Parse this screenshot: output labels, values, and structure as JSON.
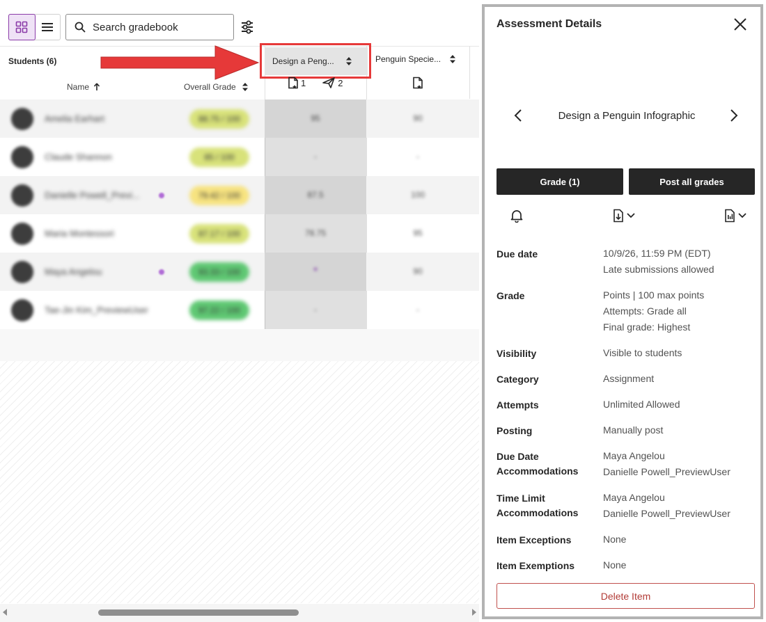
{
  "toolbar": {
    "search_placeholder": "Search gradebook"
  },
  "grid": {
    "students_label": "Students (6)",
    "name_header": "Name",
    "overall_header": "Overall Grade",
    "columns": [
      {
        "title": "Design a Peng...",
        "needs_grading_count": "1",
        "submitted_count": "2"
      },
      {
        "title": "Penguin Specie..."
      }
    ],
    "rows": [
      {
        "name": "Amelia Earhart",
        "overall": "88.75 / 100",
        "c1": "95",
        "c2": "90",
        "pill_color": "#d8e27a",
        "dot": false
      },
      {
        "name": "Claude Shannon",
        "overall": "85 / 100",
        "c1": "-",
        "c2": "-",
        "pill_color": "#d8e27a",
        "dot": false
      },
      {
        "name": "Danielle Powell_Previ...",
        "overall": "79.42 / 100",
        "c1": "87.5",
        "c2": "100",
        "pill_color": "#f7e380",
        "dot": true
      },
      {
        "name": "Maria Montessori",
        "overall": "87.17 / 100",
        "c1": "78.75",
        "c2": "95",
        "pill_color": "#d8e27a",
        "dot": false
      },
      {
        "name": "Maya Angelou",
        "overall": "93.33 / 100",
        "c1": "•",
        "c2": "90",
        "pill_color": "#5fc873",
        "dot": true
      },
      {
        "name": "Tae-Jin Kim_PreviewUser",
        "overall": "97.22 / 100",
        "c1": "-",
        "c2": "-",
        "pill_color": "#5fc873",
        "dot": false
      }
    ]
  },
  "panel": {
    "title": "Assessment Details",
    "item_name": "Design a Penguin Infographic",
    "grade_button": "Grade (1)",
    "post_button": "Post all grades",
    "details": [
      {
        "label": [
          "Due date"
        ],
        "values": [
          "10/9/26, 11:59 PM (EDT)",
          "Late submissions allowed"
        ]
      },
      {
        "label": [
          "Grade"
        ],
        "values": [
          "Points | 100 max points",
          "Attempts: Grade all",
          "Final grade: Highest"
        ]
      },
      {
        "label": [
          "Visibility"
        ],
        "values": [
          "Visible to students"
        ]
      },
      {
        "label": [
          "Category"
        ],
        "values": [
          "Assignment"
        ]
      },
      {
        "label": [
          "Attempts"
        ],
        "values": [
          "Unlimited Allowed"
        ]
      },
      {
        "label": [
          "Posting"
        ],
        "values": [
          "Manually post"
        ]
      },
      {
        "label": [
          "Due Date",
          "Accommodations"
        ],
        "values": [
          "Maya Angelou",
          "Danielle Powell_PreviewUser"
        ]
      },
      {
        "label": [
          "Time Limit",
          "Accommodations"
        ],
        "values": [
          "Maya Angelou",
          "Danielle Powell_PreviewUser"
        ]
      },
      {
        "label": [
          "Item Exceptions"
        ],
        "values": [
          "None"
        ]
      },
      {
        "label": [
          "Item Exemptions"
        ],
        "values": [
          "None"
        ]
      }
    ],
    "delete_button": "Delete Item"
  },
  "colors": {
    "accent_purple": "#8a3aa8",
    "annotation_red": "#e63939",
    "dark_button": "#262626",
    "delete_red": "#b23b36"
  }
}
